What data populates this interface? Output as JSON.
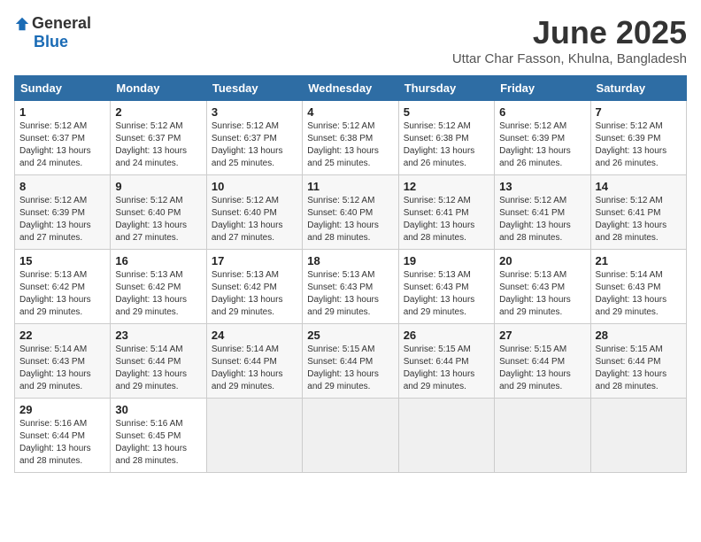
{
  "header": {
    "logo_general": "General",
    "logo_blue": "Blue",
    "title": "June 2025",
    "subtitle": "Uttar Char Fasson, Khulna, Bangladesh"
  },
  "days_of_week": [
    "Sunday",
    "Monday",
    "Tuesday",
    "Wednesday",
    "Thursday",
    "Friday",
    "Saturday"
  ],
  "weeks": [
    [
      {
        "day": "1",
        "sunrise": "5:12 AM",
        "sunset": "6:37 PM",
        "daylight": "13 hours and 24 minutes."
      },
      {
        "day": "2",
        "sunrise": "5:12 AM",
        "sunset": "6:37 PM",
        "daylight": "13 hours and 24 minutes."
      },
      {
        "day": "3",
        "sunrise": "5:12 AM",
        "sunset": "6:37 PM",
        "daylight": "13 hours and 25 minutes."
      },
      {
        "day": "4",
        "sunrise": "5:12 AM",
        "sunset": "6:38 PM",
        "daylight": "13 hours and 25 minutes."
      },
      {
        "day": "5",
        "sunrise": "5:12 AM",
        "sunset": "6:38 PM",
        "daylight": "13 hours and 26 minutes."
      },
      {
        "day": "6",
        "sunrise": "5:12 AM",
        "sunset": "6:39 PM",
        "daylight": "13 hours and 26 minutes."
      },
      {
        "day": "7",
        "sunrise": "5:12 AM",
        "sunset": "6:39 PM",
        "daylight": "13 hours and 26 minutes."
      }
    ],
    [
      {
        "day": "8",
        "sunrise": "5:12 AM",
        "sunset": "6:39 PM",
        "daylight": "13 hours and 27 minutes."
      },
      {
        "day": "9",
        "sunrise": "5:12 AM",
        "sunset": "6:40 PM",
        "daylight": "13 hours and 27 minutes."
      },
      {
        "day": "10",
        "sunrise": "5:12 AM",
        "sunset": "6:40 PM",
        "daylight": "13 hours and 27 minutes."
      },
      {
        "day": "11",
        "sunrise": "5:12 AM",
        "sunset": "6:40 PM",
        "daylight": "13 hours and 28 minutes."
      },
      {
        "day": "12",
        "sunrise": "5:12 AM",
        "sunset": "6:41 PM",
        "daylight": "13 hours and 28 minutes."
      },
      {
        "day": "13",
        "sunrise": "5:12 AM",
        "sunset": "6:41 PM",
        "daylight": "13 hours and 28 minutes."
      },
      {
        "day": "14",
        "sunrise": "5:12 AM",
        "sunset": "6:41 PM",
        "daylight": "13 hours and 28 minutes."
      }
    ],
    [
      {
        "day": "15",
        "sunrise": "5:13 AM",
        "sunset": "6:42 PM",
        "daylight": "13 hours and 29 minutes."
      },
      {
        "day": "16",
        "sunrise": "5:13 AM",
        "sunset": "6:42 PM",
        "daylight": "13 hours and 29 minutes."
      },
      {
        "day": "17",
        "sunrise": "5:13 AM",
        "sunset": "6:42 PM",
        "daylight": "13 hours and 29 minutes."
      },
      {
        "day": "18",
        "sunrise": "5:13 AM",
        "sunset": "6:43 PM",
        "daylight": "13 hours and 29 minutes."
      },
      {
        "day": "19",
        "sunrise": "5:13 AM",
        "sunset": "6:43 PM",
        "daylight": "13 hours and 29 minutes."
      },
      {
        "day": "20",
        "sunrise": "5:13 AM",
        "sunset": "6:43 PM",
        "daylight": "13 hours and 29 minutes."
      },
      {
        "day": "21",
        "sunrise": "5:14 AM",
        "sunset": "6:43 PM",
        "daylight": "13 hours and 29 minutes."
      }
    ],
    [
      {
        "day": "22",
        "sunrise": "5:14 AM",
        "sunset": "6:43 PM",
        "daylight": "13 hours and 29 minutes."
      },
      {
        "day": "23",
        "sunrise": "5:14 AM",
        "sunset": "6:44 PM",
        "daylight": "13 hours and 29 minutes."
      },
      {
        "day": "24",
        "sunrise": "5:14 AM",
        "sunset": "6:44 PM",
        "daylight": "13 hours and 29 minutes."
      },
      {
        "day": "25",
        "sunrise": "5:15 AM",
        "sunset": "6:44 PM",
        "daylight": "13 hours and 29 minutes."
      },
      {
        "day": "26",
        "sunrise": "5:15 AM",
        "sunset": "6:44 PM",
        "daylight": "13 hours and 29 minutes."
      },
      {
        "day": "27",
        "sunrise": "5:15 AM",
        "sunset": "6:44 PM",
        "daylight": "13 hours and 29 minutes."
      },
      {
        "day": "28",
        "sunrise": "5:15 AM",
        "sunset": "6:44 PM",
        "daylight": "13 hours and 28 minutes."
      }
    ],
    [
      {
        "day": "29",
        "sunrise": "5:16 AM",
        "sunset": "6:44 PM",
        "daylight": "13 hours and 28 minutes."
      },
      {
        "day": "30",
        "sunrise": "5:16 AM",
        "sunset": "6:45 PM",
        "daylight": "13 hours and 28 minutes."
      },
      {
        "day": "",
        "sunrise": "",
        "sunset": "",
        "daylight": ""
      },
      {
        "day": "",
        "sunrise": "",
        "sunset": "",
        "daylight": ""
      },
      {
        "day": "",
        "sunrise": "",
        "sunset": "",
        "daylight": ""
      },
      {
        "day": "",
        "sunrise": "",
        "sunset": "",
        "daylight": ""
      },
      {
        "day": "",
        "sunrise": "",
        "sunset": "",
        "daylight": ""
      }
    ]
  ]
}
